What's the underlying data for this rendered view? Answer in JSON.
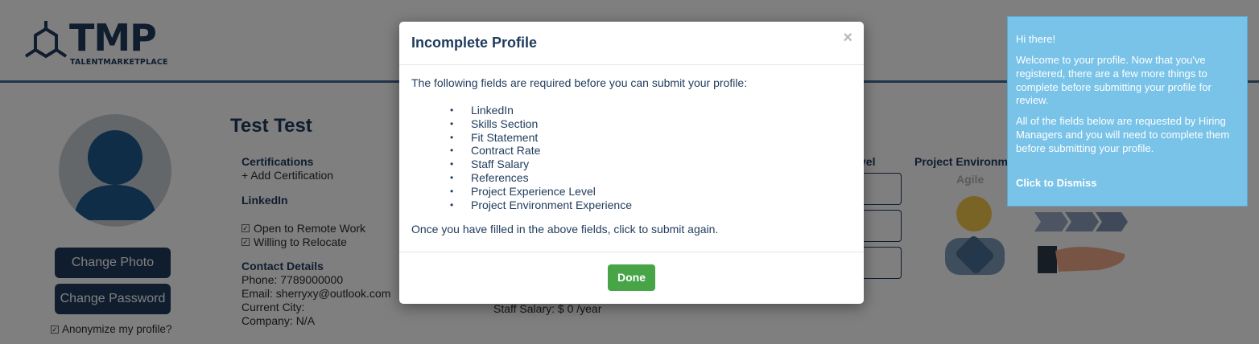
{
  "header": {
    "logo_word": "TMP",
    "logo_sub": "TALENTMARKETPLACE"
  },
  "profile": {
    "name": "Test Test",
    "change_photo_label": "Change Photo",
    "change_password_label": "Change Password",
    "anonymize_label": "Anonymize my profile?",
    "certifications_heading": "Certifications",
    "add_certification_label": "+ Add Certification",
    "linkedin_heading": "LinkedIn",
    "remote_label": "Open to Remote Work",
    "relocate_label": "Willing to Relocate",
    "contact_heading": "Contact Details",
    "phone": "Phone: 7789000000",
    "email": "Email: sherryxy@outlook.com",
    "city": "Current City:",
    "company": "Company: N/A",
    "staff_salary": "Staff Salary: $ 0 /year",
    "level_heading_fragment": "vel",
    "project_env_heading": "Project Environm",
    "agile_label": "Agile"
  },
  "modal": {
    "title": "Incomplete Profile",
    "close_glyph": "×",
    "intro": "The following fields are required before you can submit your profile:",
    "required_fields": [
      "LinkedIn",
      "Skills Section",
      "Fit Statement",
      "Contract Rate",
      "Staff Salary",
      "References",
      "Project Experience Level",
      "Project Environment Experience"
    ],
    "outro": "Once you have filled in the above fields, click to submit again.",
    "done_label": "Done"
  },
  "tooltip": {
    "greeting": "Hi there!",
    "para1": "Welcome to your profile. Now that you've registered, there are a few more things to complete before submitting your profile for review.",
    "para2": "All of the fields below are requested by Hiring Managers and you will need to complete them before submitting your profile.",
    "dismiss_label": "Click to Dismiss"
  },
  "colors": {
    "brand_navy": "#1f3b5c",
    "done_green": "#47a447",
    "tooltip_blue": "#79c3e8"
  }
}
